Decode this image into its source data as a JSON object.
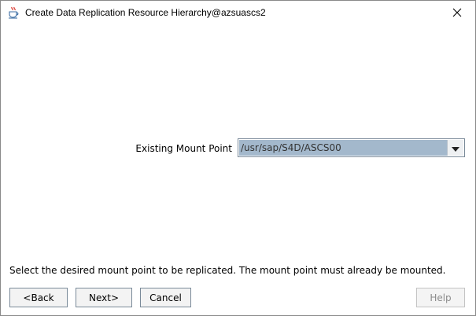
{
  "window": {
    "title": "Create Data Replication Resource Hierarchy@azsuascs2",
    "app_icon": "java-cup-icon",
    "close_icon": "close-icon"
  },
  "form": {
    "mount_point_label": "Existing Mount Point",
    "mount_point_value": "/usr/sap/S4D/ASCS00",
    "dropdown_icon": "dropdown-arrow-icon"
  },
  "hint_text": "Select the desired mount point to be replicated. The mount point must already be mounted.",
  "buttons": {
    "back": "<Back",
    "next": "Next>",
    "cancel": "Cancel",
    "help": "Help"
  }
}
